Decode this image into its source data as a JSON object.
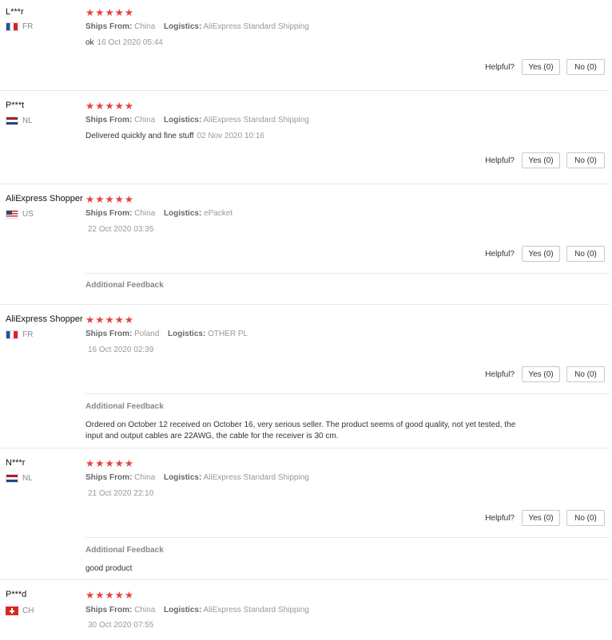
{
  "ui": {
    "ships_from_label": "Ships From:",
    "logistics_label": "Logistics:",
    "helpful_label": "Helpful?",
    "yes_label": "Yes (0)",
    "no_label": "No (0)",
    "additional_feedback_label": "Additional Feedback",
    "star_color": "#e8403d"
  },
  "reviews": [
    {
      "user": "L***r",
      "country": "FR",
      "flag_icon": "france-flag-icon",
      "rating": 5,
      "ships_from": "China",
      "logistics": "AliExpress Standard Shipping",
      "text": "ok",
      "date": "16 Oct 2020 05:44"
    },
    {
      "user": "P***t",
      "country": "NL",
      "flag_icon": "netherlands-flag-icon",
      "rating": 5,
      "ships_from": "China",
      "logistics": "AliExpress Standard Shipping",
      "text": "Delivered quickly and fine stuff",
      "date": "02 Nov 2020 10:16"
    },
    {
      "user": "AliExpress Shopper",
      "country": "US",
      "flag_icon": "usa-flag-icon",
      "rating": 5,
      "ships_from": "China",
      "logistics": "ePacket",
      "text": "",
      "date": "22 Oct 2020 03:35",
      "additional_feedback": ""
    },
    {
      "user": "AliExpress Shopper",
      "country": "FR",
      "flag_icon": "france-flag-icon",
      "rating": 5,
      "ships_from": "Poland",
      "logistics": "OTHER PL",
      "text": "",
      "date": "16 Oct 2020 02:39",
      "additional_feedback": "Ordered on October 12 received on October 16, very serious seller. The product seems of good quality, not yet tested, the input and output cables are 22AWG, the cable for the receiver is 30 cm."
    },
    {
      "user": "N***r",
      "country": "NL",
      "flag_icon": "netherlands-flag-icon",
      "rating": 5,
      "ships_from": "China",
      "logistics": "AliExpress Standard Shipping",
      "text": "",
      "date": "21 Oct 2020 22:10",
      "additional_feedback": "good product"
    },
    {
      "user": "P***d",
      "country": "CH",
      "flag_icon": "switzerland-flag-icon",
      "rating": 5,
      "ships_from": "China",
      "logistics": "AliExpress Standard Shipping",
      "text": "",
      "date": "30 Oct 2020 07:55"
    }
  ]
}
